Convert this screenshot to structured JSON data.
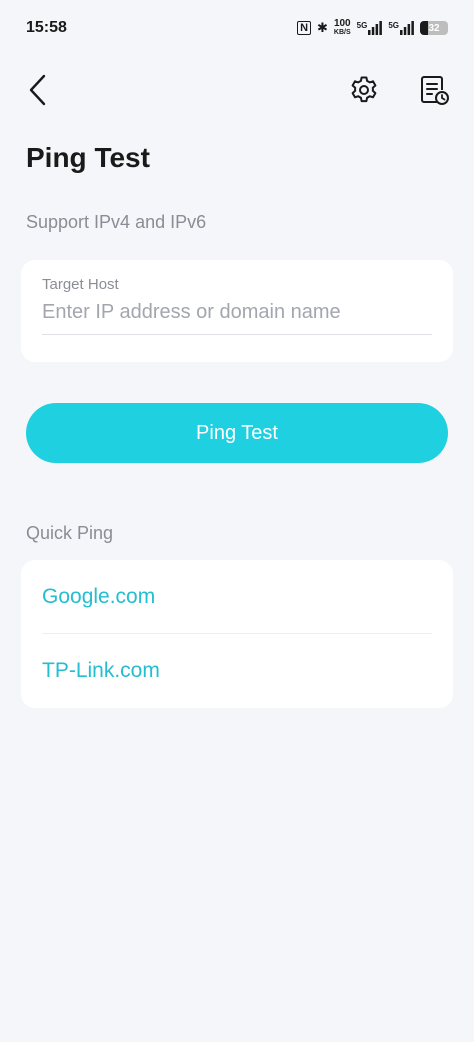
{
  "status_bar": {
    "time": "15:58",
    "nfc": "N",
    "bluetooth": "✱",
    "speed_value": "100",
    "speed_unit": "KB/S",
    "sim1": "5G",
    "sim2": "5G",
    "battery": "32"
  },
  "nav": {
    "back_icon": "chevron-left-icon",
    "settings_icon": "gear-icon",
    "history_icon": "history-document-icon"
  },
  "page": {
    "title": "Ping Test",
    "subtitle": "Support IPv4 and IPv6"
  },
  "target_host": {
    "label": "Target Host",
    "placeholder": "Enter IP address or domain name",
    "value": ""
  },
  "actions": {
    "ping_button": "Ping Test"
  },
  "quick_ping": {
    "label": "Quick Ping",
    "items": [
      {
        "label": "Google.com"
      },
      {
        "label": "TP-Link.com"
      }
    ]
  },
  "colors": {
    "accent": "#1fd0e0",
    "link": "#23bed0",
    "background": "#f5f6fa"
  }
}
